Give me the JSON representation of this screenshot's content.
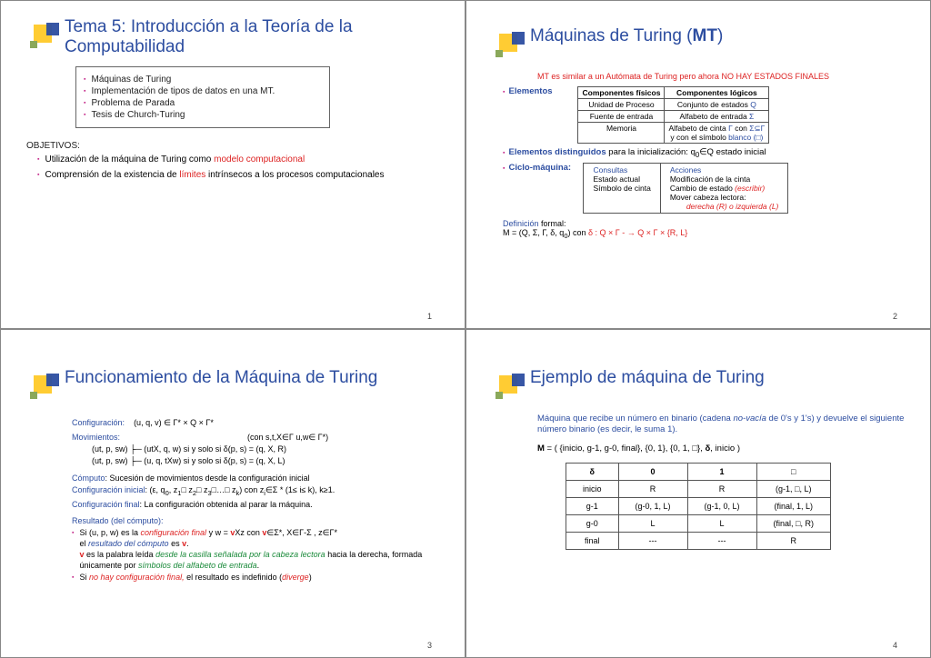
{
  "slide1": {
    "title": "Tema 5: Introducción a la Teoría de la Computabilidad",
    "bullets": [
      "Máquinas de Turing",
      "Implementación de tipos de datos en una MT.",
      "Problema de Parada",
      "Tesis de Church-Turing"
    ],
    "objLabel": "OBJETIVOS:",
    "obj1a": "Utilización de la máquina de Turing como ",
    "obj1b": "modelo computacional",
    "obj2a": "Comprensión de la existencia de ",
    "obj2b": "límites",
    "obj2c": " intrínsecos a los procesos computacionales",
    "page": "1"
  },
  "slide2": {
    "title_a": "Máquinas de Turing (",
    "title_b": "MT",
    "title_c": ")",
    "note": "MT es similar a un Autómata de Turing pero ahora NO HAY ESTADOS FINALES",
    "elementos": "Elementos",
    "th1": "Componentes físicos",
    "th2": "Componentes lógicos",
    "r1c1": "Unidad de Proceso",
    "r1c2a": "Conjunto de estados   ",
    "r1c2b": "Q",
    "r2c1": "Fuente de entrada",
    "r2c2a": "Alfabeto de entrada  ",
    "r2c2b": "Σ",
    "r3c1": "Memoria",
    "r3c2a": "Alfabeto de cinta ",
    "r3c2b": "Γ",
    "r3c2c": " con ",
    "r3c2d": "Σ⊆Γ",
    "r3c2e": "y con el símbolo ",
    "r3c2f": "blanco (□)",
    "disting_a": "Elementos distinguidos",
    "disting_b": " para la inicialización:    q",
    "disting_c": "∈Q   estado inicial",
    "ciclo": "Ciclo-máquina:",
    "cons": "Consultas",
    "acc": "Acciones",
    "cons1": "Estado actual",
    "cons2": "Símbolo de cinta",
    "acc1": "Modificación de la cinta",
    "acc2a": "Cambio de estado ",
    "acc2b": "(escribir)",
    "acc3a": "Mover cabeza lectora:",
    "acc3b": "derecha (R) o izquierda (L)",
    "defLabel": "Definición",
    "defLabel2": " formal:",
    "defM": "M = (Q, Σ, Γ, δ, q",
    "defM2": ") con    ",
    "delta": "δ : Q × Γ   -  → Q × Γ ×  {R, L}",
    "page": "2"
  },
  "slide3": {
    "title": "Funcionamiento de la Máquina de Turing",
    "conf": "Configuración:",
    "confv": "(u, q, v) ∈ Γ* × Q × Γ*",
    "mov": "Movimientos:",
    "movcond": "(con   s,t,X∈Γ   u,w∈ Γ*)",
    "mv1": "(ut, p, sw) ├─  (utX, q, w)   si y solo si   δ(p, s) = (q, X, R)",
    "mv2": "(ut, p, sw) ├─  (u, q, tXw)   si y solo si   δ(p, s) = (q, X, L)",
    "comp_a": "Cómputo",
    "comp_b": ": Sucesión de movimientos desde la configuración inicial",
    "cini_a": "Configuración inicial",
    "cini_b": ":   (ε, q",
    "cini_c": ", z",
    "cini_d": "□ z",
    "cini_e": "□ z",
    "cini_f": "□…□ z",
    "cini_g": ")  con z",
    "cini_h": "∈Σ * (1≤ i≤ k), k≥1.",
    "cfin_a": "Configuración final",
    "cfin_b": ":  La configuración obtenida al parar la máquina.",
    "res": "Resultado (del cómputo):",
    "r1a": "Si (u, p, w) es la ",
    "r1b": "configuración final",
    "r1c": "  y   w = ",
    "r1d": "v",
    "r1e": "Xz con ",
    "r1f": "v",
    "r1g": "∈Σ*, X∈Γ-Σ , z∈Γ*",
    "r1h": "el ",
    "r1i": "resultado del cómputo",
    "r1j": " es ",
    "r1k": "v",
    "r1l": ".",
    "r2a": "v",
    "r2b": " es la palabra leída ",
    "r2c": "desde la casilla señalada por la cabeza lectora",
    "r2d": " hacia la derecha, formada únicamente por ",
    "r2e": "símbolos del alfabeto de entrada",
    "r2f": ".",
    "r3a": "Si ",
    "r3b": "no hay configuración final,",
    "r3c": " el resultado es indefinido (",
    "r3d": "diverge",
    "r3e": ")",
    "page": "3"
  },
  "slide4": {
    "title": "Ejemplo de máquina de Turing",
    "desc1": "Máquina que recibe un número en binario (cadena ",
    "desc1i": "no-vacía",
    "desc1b": " de 0's y 1's) y devuelve el siguiente número binario (es decir, le suma 1).",
    "mdef": "M = ( {inicio, g-1, g-0, final}, {0, 1}, {0, 1, □}, δ, inicio )",
    "th0": "δ",
    "th1": "0",
    "th2": "1",
    "th3": "□",
    "rows": [
      [
        "inicio",
        "R",
        "R",
        "(g-1, □, L)"
      ],
      [
        "g-1",
        "(g-0, 1, L)",
        "(g-1, 0, L)",
        "(final, 1, L)"
      ],
      [
        "g-0",
        "L",
        "L",
        "(final, □, R)"
      ],
      [
        "final",
        "---",
        "---",
        "R"
      ]
    ],
    "page": "4"
  }
}
